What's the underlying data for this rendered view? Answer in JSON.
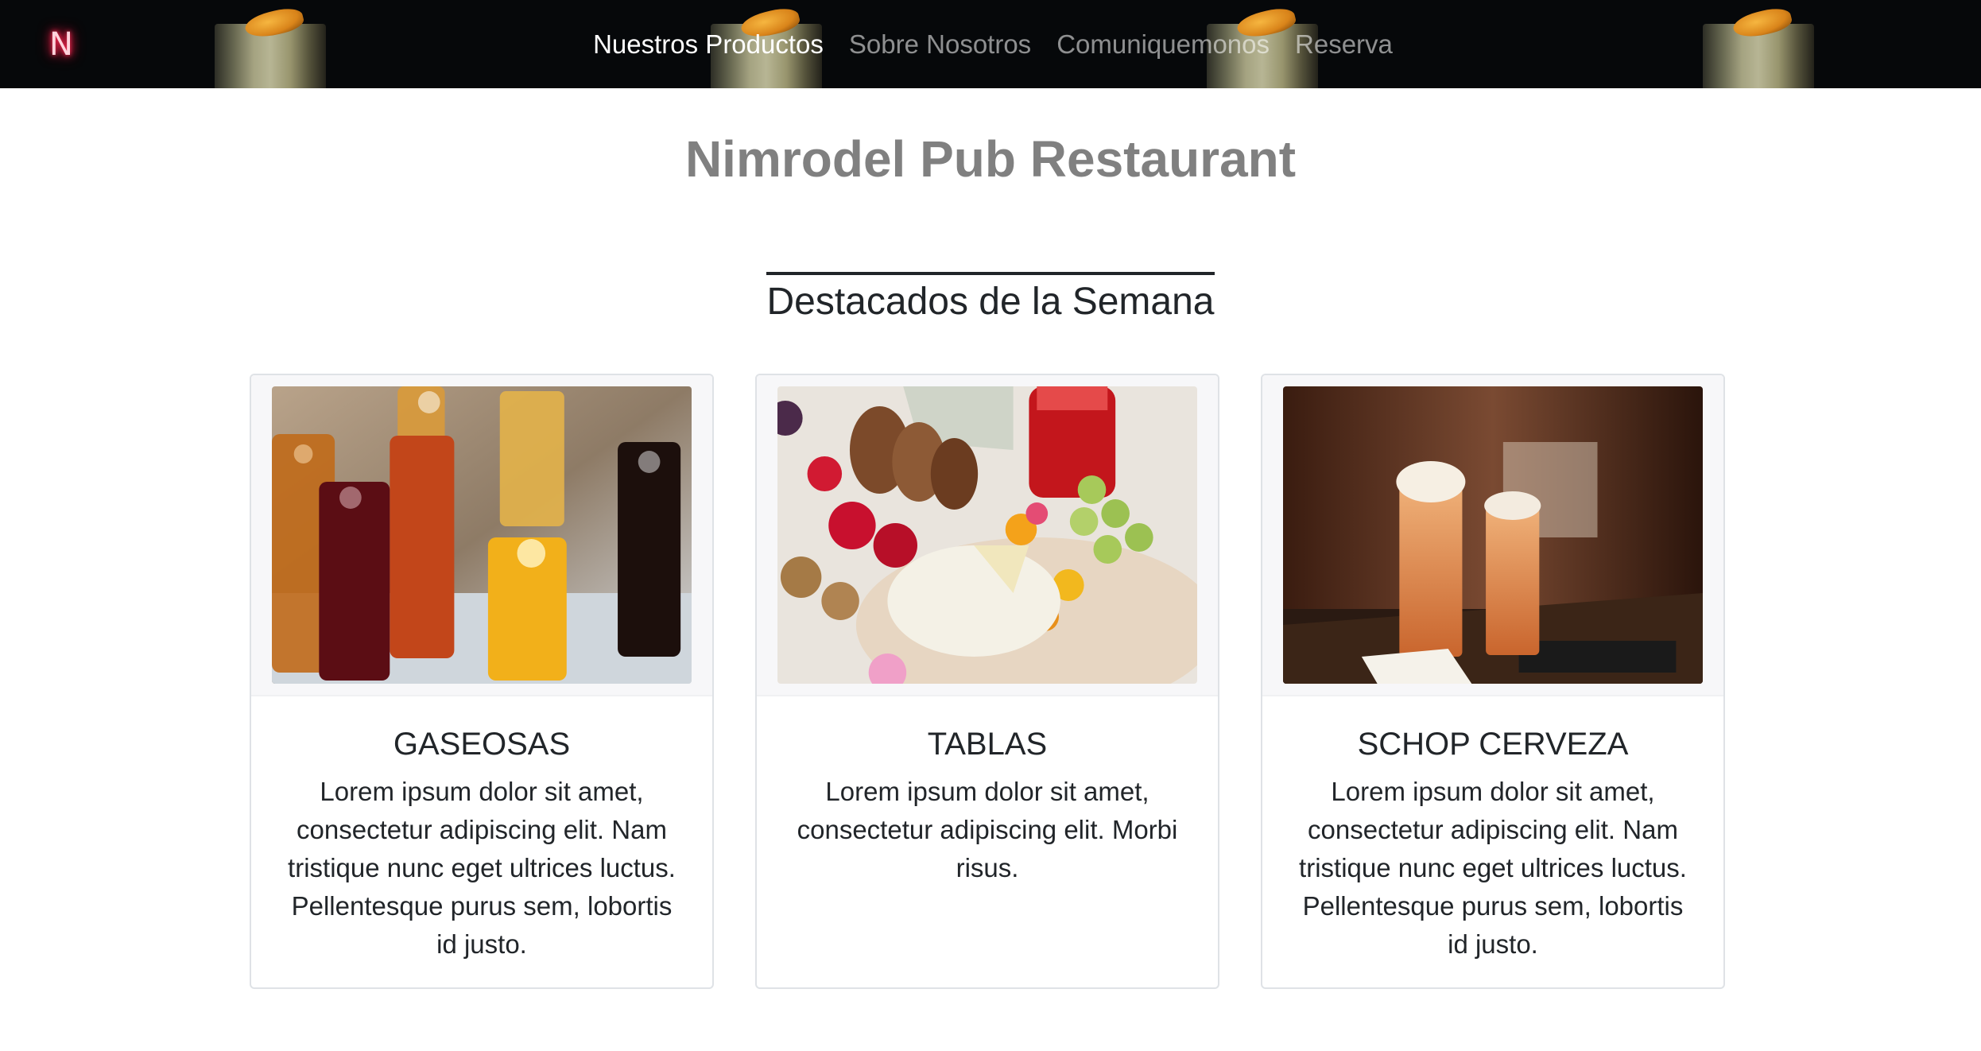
{
  "navbar": {
    "brand": "N",
    "links": [
      {
        "label": "Nuestros Productos",
        "active": true
      },
      {
        "label": "Sobre Nosotros",
        "active": false
      },
      {
        "label": "Comuniquemonos",
        "active": false
      },
      {
        "label": "Reserva",
        "active": false
      }
    ]
  },
  "header": {
    "title": "Nimrodel Pub Restaurant",
    "section_title": "Destacados de la Semana"
  },
  "cards": [
    {
      "title": "GASEOSAS",
      "text": "Lorem ipsum dolor sit amet, consectetur adipiscing elit. Nam tristique nunc eget ultrices luctus. Pellentesque purus sem, lobortis id justo."
    },
    {
      "title": "TABLAS",
      "text": "Lorem ipsum dolor sit amet, consectetur adipiscing elit. Morbi risus."
    },
    {
      "title": "SCHOP CERVEZA",
      "text": "Lorem ipsum dolor sit amet, consectetur adipiscing elit. Nam tristique nunc eget ultrices luctus. Pellentesque purus sem, lobortis id justo."
    }
  ],
  "colors": {
    "navbar_bg": "#06080a",
    "brand_glow": "#ff2b55",
    "title_gray": "#808080",
    "text_dark": "#212529"
  }
}
